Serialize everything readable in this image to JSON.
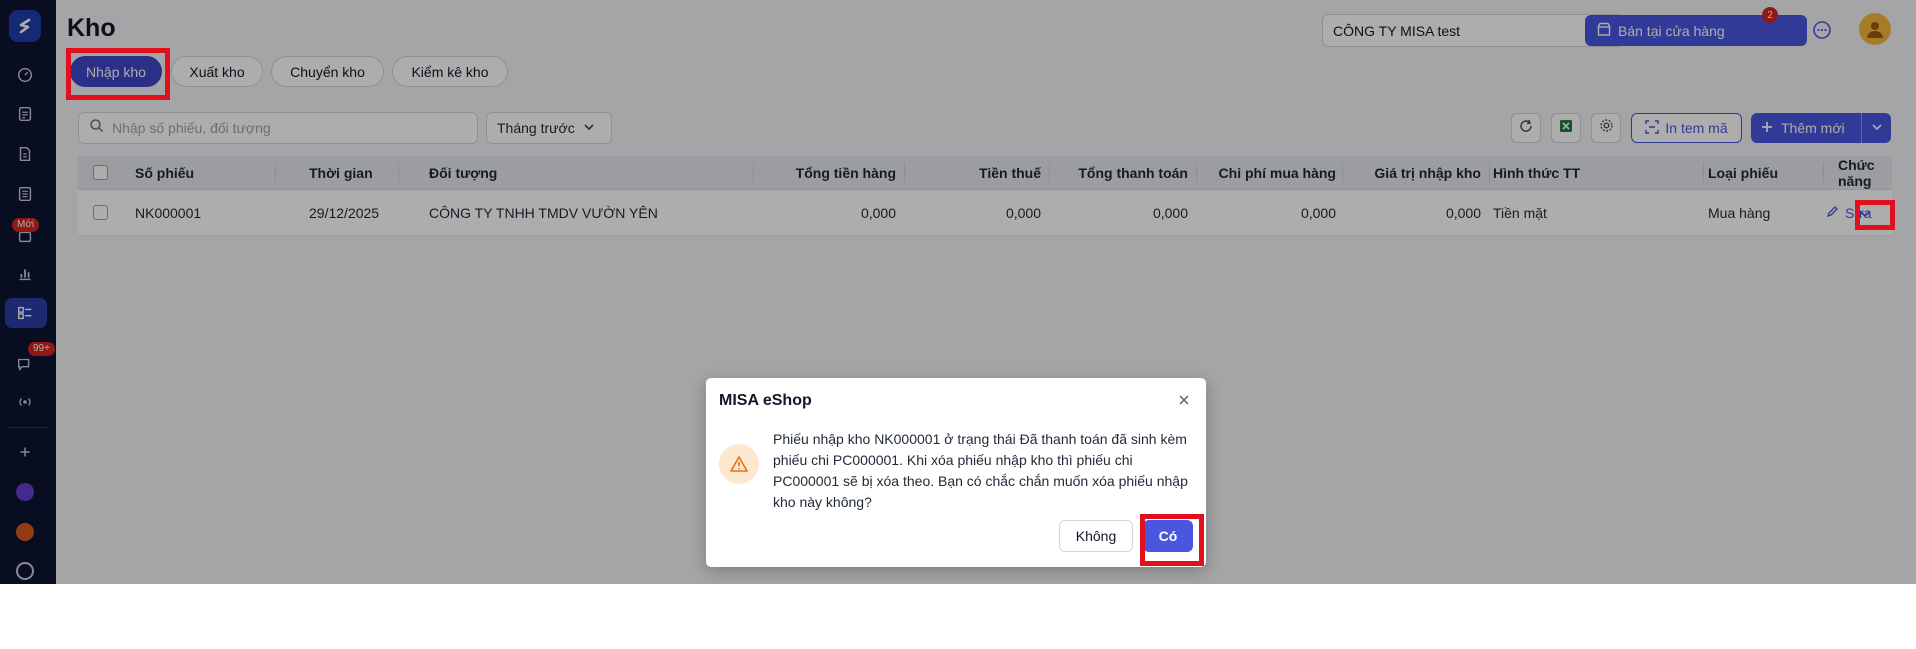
{
  "page": {
    "title": "Kho"
  },
  "header": {
    "company": "CÔNG TY MISA test",
    "store_button": "Bán tại cửa hàng",
    "notification_count": "2"
  },
  "sidebar": {
    "badge_new": "Mới",
    "badge_messages": "99+"
  },
  "tabs": [
    {
      "label": "Nhập kho",
      "active": true
    },
    {
      "label": "Xuất kho",
      "active": false
    },
    {
      "label": "Chuyển kho",
      "active": false
    },
    {
      "label": "Kiểm kê kho",
      "active": false
    }
  ],
  "toolbar": {
    "search_placeholder": "Nhập số phiếu, đối tượng",
    "period": "Tháng trước",
    "print_label": "In tem mã",
    "add_label": "Thêm mới"
  },
  "table": {
    "columns": [
      "Số phiếu",
      "Thời gian",
      "Đối tượng",
      "Tổng tiền hàng",
      "Tiền thuế",
      "Tổng thanh toán",
      "Chi phí mua hàng",
      "Giá trị nhập kho",
      "Hình thức TT",
      "Loại phiếu",
      "Chức năng"
    ],
    "rows": [
      {
        "code": "NK000001",
        "date": "29/12/2025",
        "partner": "CÔNG TY TNHH TMDV VƯỜN YÊN",
        "goods_total": "0,000",
        "tax": "0,000",
        "payment_total": "0,000",
        "purchase_cost": "0,000",
        "stock_value": "0,000",
        "payment_method": "Tiền mặt",
        "voucher_type": "Mua hàng",
        "action": "Sửa"
      }
    ]
  },
  "dialog": {
    "title": "MISA eShop",
    "message": "Phiếu nhập kho NK000001 ở trạng thái Đã thanh toán đã sinh kèm phiếu chi PC000001. Khi xóa phiếu nhập kho thì phiếu chi PC000001 sẽ bị xóa theo. Bạn có chắc chắn muốn xóa phiếu nhập kho này không?",
    "no_label": "Không",
    "yes_label": "Có"
  },
  "colors": {
    "sidebar": "#0d1433",
    "accent": "#4b56e0",
    "highlight": "#e0101c"
  }
}
